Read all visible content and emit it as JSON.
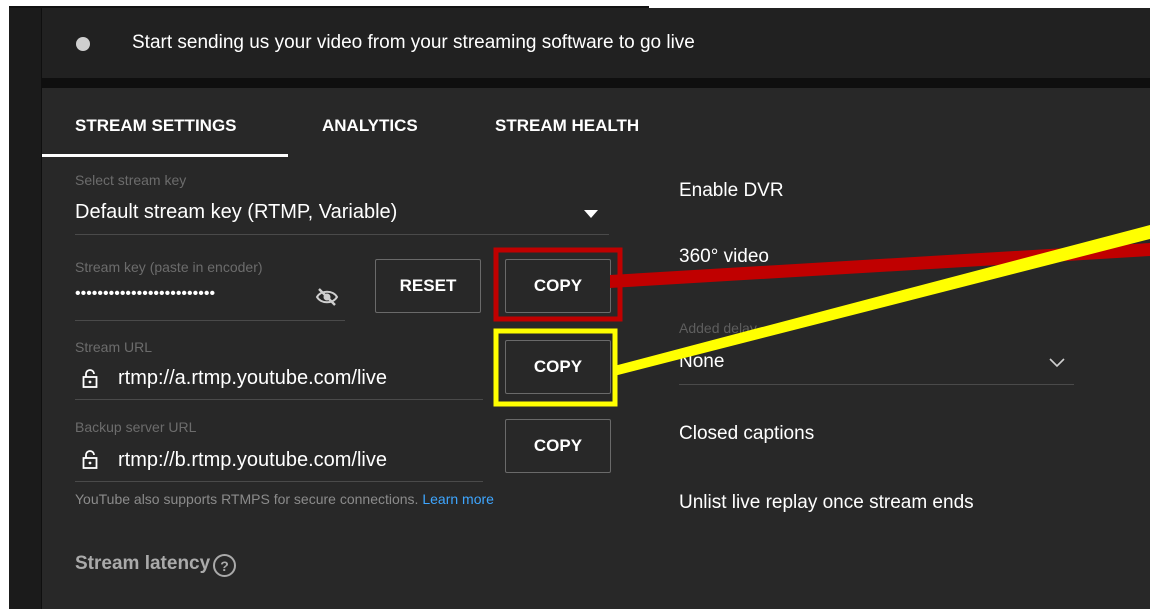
{
  "status": {
    "message": "Start sending us your video from your streaming software to go live"
  },
  "tabs": [
    {
      "label": "STREAM SETTINGS",
      "active": true
    },
    {
      "label": "ANALYTICS",
      "active": false
    },
    {
      "label": "STREAM HEALTH",
      "active": false
    }
  ],
  "stream_key_select": {
    "label": "Select stream key",
    "value": "Default stream key (RTMP, Variable)"
  },
  "stream_key": {
    "label": "Stream key (paste in encoder)",
    "value": "•••••••••••••••••••••••••",
    "reset_label": "RESET",
    "copy_label": "COPY"
  },
  "stream_url": {
    "label": "Stream URL",
    "value": "rtmp://a.rtmp.youtube.com/live",
    "copy_label": "COPY"
  },
  "backup_url": {
    "label": "Backup server URL",
    "value": "rtmp://b.rtmp.youtube.com/live",
    "copy_label": "COPY"
  },
  "helper": {
    "text": "YouTube also supports RTMPS for secure connections.",
    "link": "Learn more"
  },
  "latency": {
    "label": "Stream latency",
    "help_icon": "?"
  },
  "right": {
    "enable_dvr": "Enable DVR",
    "video_360": "360° video",
    "added_delay_label": "Added delay",
    "added_delay_value": "None",
    "closed_captions": "Closed captions",
    "unlist_replay": "Unlist live replay once stream ends"
  },
  "annotations": {
    "red": "#c00000",
    "yellow": "#ffff00"
  }
}
